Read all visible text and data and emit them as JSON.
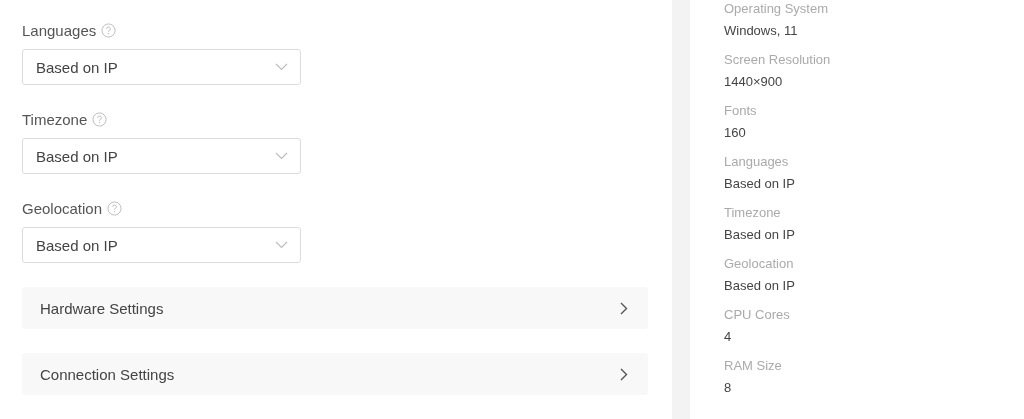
{
  "settings": [
    {
      "label": "Languages",
      "value": "Based on IP"
    },
    {
      "label": "Timezone",
      "value": "Based on IP"
    },
    {
      "label": "Geolocation",
      "value": "Based on IP"
    }
  ],
  "sections": [
    {
      "title": "Hardware Settings",
      "expanded": false
    },
    {
      "title": "Connection Settings",
      "expanded": false
    }
  ],
  "summary": [
    {
      "label": "Operating System",
      "value": "Windows, 11"
    },
    {
      "label": "Screen Resolution",
      "value": "1440×900"
    },
    {
      "label": "Fonts",
      "value": "160"
    },
    {
      "label": "Languages",
      "value": "Based on IP"
    },
    {
      "label": "Timezone",
      "value": "Based on IP"
    },
    {
      "label": "Geolocation",
      "value": "Based on IP"
    },
    {
      "label": "CPU Cores",
      "value": "4"
    },
    {
      "label": "RAM Size",
      "value": "8"
    }
  ]
}
